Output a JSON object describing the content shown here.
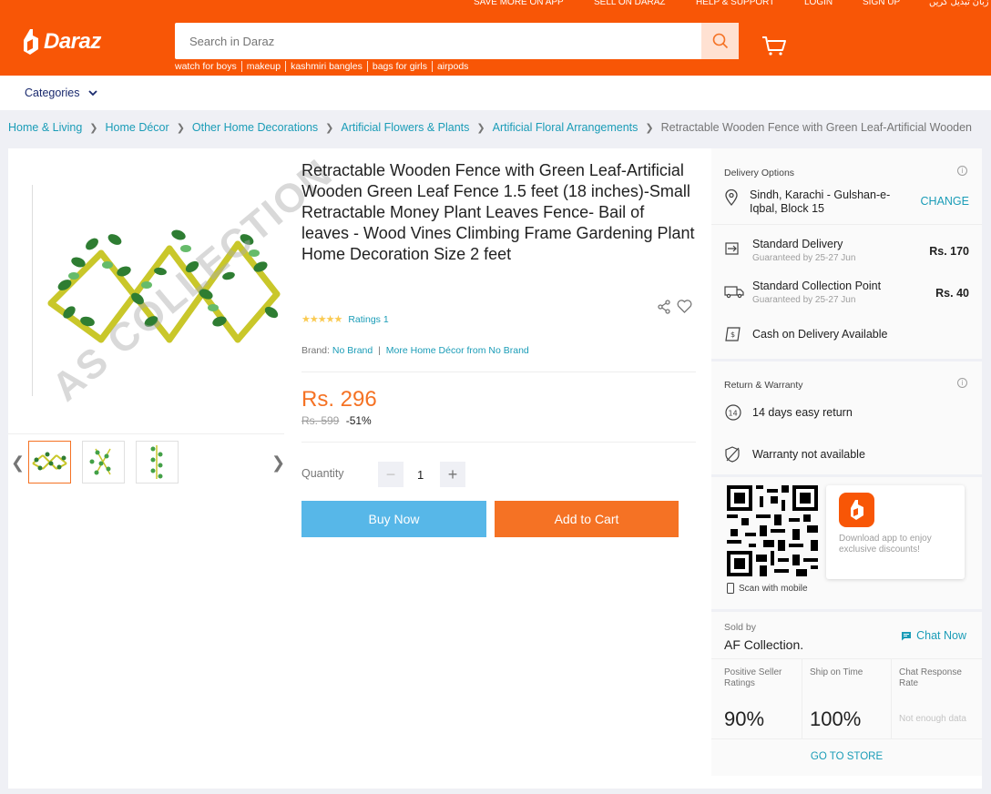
{
  "top_nav": [
    "SAVE MORE ON APP",
    "SELL ON DARAZ",
    "HELP & SUPPORT",
    "LOGIN",
    "SIGN UP",
    "زبان تبدیل کریں"
  ],
  "logo": {
    "text": "Daraz"
  },
  "search": {
    "placeholder": "Search in Daraz"
  },
  "suggestions": [
    "watch for boys",
    "makeup",
    "kashmiri bangles",
    "bags for girls",
    "airpods"
  ],
  "categories_label": "Categories",
  "breadcrumb": [
    "Home & Living",
    "Home Décor",
    "Other Home Decorations",
    "Artificial Flowers & Plants",
    "Artificial Floral Arrangements"
  ],
  "breadcrumb_current": "Retractable Wooden Fence with Green Leaf-Artificial Wooden",
  "product": {
    "watermark": "AS COLLECTION",
    "title": "Retractable Wooden Fence with Green Leaf-Artificial Wooden Green Leaf Fence 1.5 feet (18 inches)-Small Retractable Money Plant Leaves Fence- Bail of leaves - Wood Vines Climbing Frame Gardening Plant Home Decoration Size 2 feet",
    "stars": "★★★★★",
    "ratings": "Ratings 1",
    "brand_label": "Brand:",
    "brand": "No Brand",
    "more_from": "More Home Décor from No Brand",
    "price": "Rs. 296",
    "original_price": "Rs. 599",
    "discount": "-51%",
    "quantity_label": "Quantity",
    "quantity": "1",
    "buy_now": "Buy Now",
    "add_to_cart": "Add to Cart"
  },
  "delivery": {
    "heading": "Delivery Options",
    "location": "Sindh, Karachi - Gulshan-e-Iqbal, Block 15",
    "change": "CHANGE",
    "options": [
      {
        "name": "Standard Delivery",
        "guarantee": "Guaranteed by 25-27 Jun",
        "price": "Rs. 170"
      },
      {
        "name": "Standard Collection Point",
        "guarantee": "Guaranteed by 25-27 Jun",
        "price": "Rs. 40"
      }
    ],
    "cod": "Cash on Delivery Available"
  },
  "warranty": {
    "heading": "Return & Warranty",
    "return": "14 days easy return",
    "warranty": "Warranty not available"
  },
  "app_promo": {
    "text": "Download app to enjoy exclusive discounts!",
    "scan": "Scan with mobile"
  },
  "seller": {
    "sold_by": "Sold by",
    "name": "AF Collection.",
    "chat": "Chat Now",
    "metrics": [
      {
        "label": "Positive Seller Ratings",
        "value": "90%"
      },
      {
        "label": "Ship on Time",
        "value": "100%"
      },
      {
        "label": "Chat Response Rate",
        "value": "Not enough data"
      }
    ],
    "go_store": "GO TO STORE"
  },
  "colors": {
    "brand": "#f85606",
    "accent": "#f57224",
    "link": "#1a9cb7",
    "buy": "#57b7e8"
  }
}
